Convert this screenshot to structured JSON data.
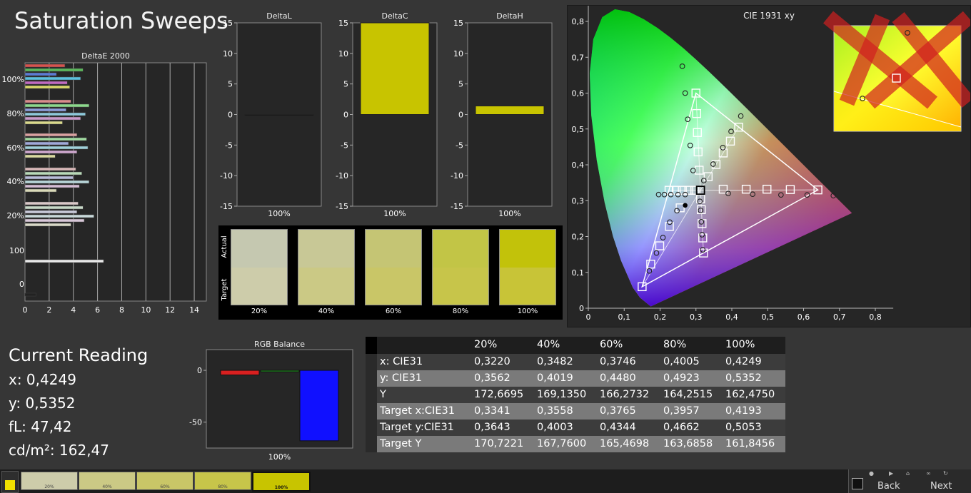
{
  "title": "Saturation Sweeps",
  "colors": {
    "background": "#363636",
    "plot_bg": "#262626",
    "delta_bar": "#c8c400",
    "rgb_red": "#d92020",
    "rgb_green": "#20a020",
    "rgb_blue": "#1010ff"
  },
  "chart_data": [
    {
      "type": "bar",
      "orientation": "horizontal",
      "title": "DeltaE 2000",
      "xlim": [
        0,
        15
      ],
      "x_ticks": [
        "0",
        "2",
        "4",
        "6",
        "8",
        "10",
        "12",
        "14"
      ],
      "y_labels": [
        "100%",
        "80%",
        "60%",
        "40%",
        "20%",
        "100",
        "0"
      ],
      "groups": [
        {
          "label": "100%",
          "values": [
            3.3,
            4.8,
            2.6,
            4.6,
            3.5,
            3.7
          ],
          "colors": [
            "#d9534f",
            "#5cb85c",
            "#5b7bd5",
            "#5bc0de",
            "#c06ac0",
            "#d9d96a"
          ]
        },
        {
          "label": "80%",
          "values": [
            3.8,
            5.3,
            3.4,
            5.0,
            4.6,
            3.1
          ],
          "colors": [
            "#d98c8c",
            "#8cd98c",
            "#8c9cd9",
            "#8cc8d9",
            "#c99ac9",
            "#d9d98c"
          ]
        },
        {
          "label": "60%",
          "values": [
            4.3,
            5.1,
            3.6,
            5.2,
            4.3,
            2.5
          ],
          "colors": [
            "#d9a0a0",
            "#a0d9a0",
            "#a0a8d9",
            "#a0d0d9",
            "#cfa8cf",
            "#d9d9a0"
          ]
        },
        {
          "label": "40%",
          "values": [
            4.2,
            4.7,
            4.0,
            5.3,
            4.5,
            2.6
          ],
          "colors": [
            "#d9b8b8",
            "#b8d9b8",
            "#b8bcd9",
            "#b8d6d9",
            "#d4bcd4",
            "#d9d9b8"
          ]
        },
        {
          "label": "20%",
          "values": [
            4.4,
            4.8,
            4.3,
            5.7,
            4.9,
            3.8
          ],
          "colors": [
            "#d9c8c8",
            "#c8d9c8",
            "#c8cad9",
            "#c8d8d9",
            "#d8c8d8",
            "#d9d9c8"
          ]
        },
        {
          "label": "100",
          "values": [
            6.5
          ],
          "colors": [
            "#e8e8e8"
          ]
        },
        {
          "label": "0",
          "values": [
            0.9
          ],
          "colors": [
            "#222222"
          ]
        }
      ]
    },
    {
      "type": "bar",
      "title": "DeltaL",
      "categories": [
        "100%"
      ],
      "values": [
        0
      ],
      "ylim": [
        -15,
        15
      ],
      "y_ticks": [
        "15",
        "10",
        "5",
        "0",
        "-5",
        "-10",
        "-15"
      ]
    },
    {
      "type": "bar",
      "title": "DeltaC",
      "categories": [
        "100%"
      ],
      "values": [
        15
      ],
      "ylim": [
        -15,
        15
      ],
      "y_ticks": [
        "15",
        "10",
        "5",
        "0",
        "-5",
        "-10",
        "-15"
      ]
    },
    {
      "type": "bar",
      "title": "DeltaH",
      "categories": [
        "100%"
      ],
      "values": [
        1.4
      ],
      "ylim": [
        -15,
        15
      ],
      "y_ticks": [
        "15",
        "10",
        "5",
        "0",
        "-5",
        "-10",
        "-15"
      ]
    },
    {
      "type": "scatter",
      "title": "CIE 1931 xy",
      "xlim": [
        0,
        0.85
      ],
      "ylim": [
        0,
        0.85
      ],
      "x_ticks": [
        "0",
        "0,1",
        "0,2",
        "0,3",
        "0,4",
        "0,5",
        "0,6",
        "0,7",
        "0,8"
      ],
      "y_ticks": [
        "0",
        "0,1",
        "0,2",
        "0,3",
        "0,4",
        "0,5",
        "0,6",
        "0,7",
        "0,8"
      ],
      "gamut_triangle": [
        [
          0.64,
          0.33
        ],
        [
          0.3,
          0.6
        ],
        [
          0.15,
          0.06
        ]
      ],
      "white_point": [
        0.3127,
        0.329
      ],
      "targets": [
        [
          0.64,
          0.33
        ],
        [
          0.563,
          0.331
        ],
        [
          0.498,
          0.332
        ],
        [
          0.44,
          0.332
        ],
        [
          0.376,
          0.332
        ],
        [
          0.3,
          0.6
        ],
        [
          0.302,
          0.543
        ],
        [
          0.304,
          0.49
        ],
        [
          0.306,
          0.436
        ],
        [
          0.309,
          0.385
        ],
        [
          0.15,
          0.06
        ],
        [
          0.174,
          0.123
        ],
        [
          0.199,
          0.174
        ],
        [
          0.226,
          0.228
        ],
        [
          0.256,
          0.28
        ],
        [
          0.419,
          0.505
        ],
        [
          0.396,
          0.466
        ],
        [
          0.376,
          0.433
        ],
        [
          0.356,
          0.401
        ],
        [
          0.334,
          0.367
        ],
        [
          0.321,
          0.154
        ],
        [
          0.319,
          0.196
        ],
        [
          0.317,
          0.236
        ],
        [
          0.315,
          0.275
        ],
        [
          0.313,
          0.305
        ],
        [
          0.225,
          0.329
        ],
        [
          0.245,
          0.329
        ],
        [
          0.262,
          0.329
        ],
        [
          0.28,
          0.329
        ],
        [
          0.297,
          0.329
        ]
      ],
      "measured": [
        [
          0.683,
          0.314
        ],
        [
          0.61,
          0.316
        ],
        [
          0.537,
          0.316
        ],
        [
          0.458,
          0.318
        ],
        [
          0.39,
          0.32
        ],
        [
          0.262,
          0.675
        ],
        [
          0.27,
          0.6
        ],
        [
          0.277,
          0.527
        ],
        [
          0.284,
          0.454
        ],
        [
          0.292,
          0.384
        ],
        [
          0.17,
          0.104
        ],
        [
          0.19,
          0.154
        ],
        [
          0.208,
          0.197
        ],
        [
          0.227,
          0.24
        ],
        [
          0.247,
          0.272
        ],
        [
          0.425,
          0.536
        ],
        [
          0.398,
          0.493
        ],
        [
          0.375,
          0.448
        ],
        [
          0.348,
          0.402
        ],
        [
          0.322,
          0.356
        ],
        [
          0.319,
          0.163
        ],
        [
          0.317,
          0.205
        ],
        [
          0.315,
          0.241
        ],
        [
          0.313,
          0.273
        ],
        [
          0.311,
          0.298
        ],
        [
          0.196,
          0.317
        ],
        [
          0.212,
          0.317
        ],
        [
          0.23,
          0.317
        ],
        [
          0.25,
          0.317
        ],
        [
          0.27,
          0.317
        ]
      ],
      "current": [
        0.27,
        0.287
      ]
    },
    {
      "type": "bar",
      "title": "RGB Balance",
      "categories": [
        "100%"
      ],
      "series": [
        {
          "values": [
            -4.5
          ],
          "color": "#d92020"
        },
        {
          "values": [
            -0.5
          ],
          "color": "#20a020"
        },
        {
          "values": [
            -68
          ],
          "color": "#1010ff"
        }
      ],
      "ylim": [
        -75,
        20
      ],
      "y_ticks": [
        "50",
        "0",
        "-50"
      ]
    }
  ],
  "swatches": {
    "row_labels": [
      "Actual",
      "Target"
    ],
    "items": [
      {
        "label": "20%",
        "actual": "#c5c8b0",
        "target": "#cdccaa"
      },
      {
        "label": "40%",
        "actual": "#c8c896",
        "target": "#cbc985"
      },
      {
        "label": "60%",
        "actual": "#c5c574",
        "target": "#c9c667"
      },
      {
        "label": "80%",
        "actual": "#c2c546",
        "target": "#c7c54a"
      },
      {
        "label": "100%",
        "actual": "#c2c20a",
        "target": "#c8c437"
      }
    ]
  },
  "current_reading": {
    "title": "Current Reading",
    "x": "x: 0,4249",
    "y": "y: 0,5352",
    "fl": "fL: 47,42",
    "cdm2": "cd/m²: 162,47"
  },
  "table": {
    "headers": [
      "",
      "20%",
      "40%",
      "60%",
      "80%",
      "100%"
    ],
    "rows": [
      [
        "x: CIE31",
        "0,3220",
        "0,3482",
        "0,3746",
        "0,4005",
        "0,4249"
      ],
      [
        "y: CIE31",
        "0,3562",
        "0,4019",
        "0,4480",
        "0,4923",
        "0,5352"
      ],
      [
        "Y",
        "172,6695",
        "169,1350",
        "166,2732",
        "164,2515",
        "162,4750"
      ],
      [
        "Target x:CIE31",
        "0,3341",
        "0,3558",
        "0,3765",
        "0,3957",
        "0,4193"
      ],
      [
        "Target y:CIE31",
        "0,3643",
        "0,4003",
        "0,4344",
        "0,4662",
        "0,5053"
      ],
      [
        "Target Y",
        "170,7221",
        "167,7600",
        "165,4698",
        "163,6858",
        "161,8456"
      ]
    ]
  },
  "bottom_bar": {
    "swatches": [
      {
        "label": "20%",
        "color": "#cdccaa"
      },
      {
        "label": "40%",
        "color": "#cbc985"
      },
      {
        "label": "60%",
        "color": "#c9c667"
      },
      {
        "label": "80%",
        "color": "#c7c54a"
      },
      {
        "label": "100%",
        "color": "#c8c400"
      }
    ],
    "active_color": "#f0e000",
    "back": "Back",
    "next": "Next"
  }
}
